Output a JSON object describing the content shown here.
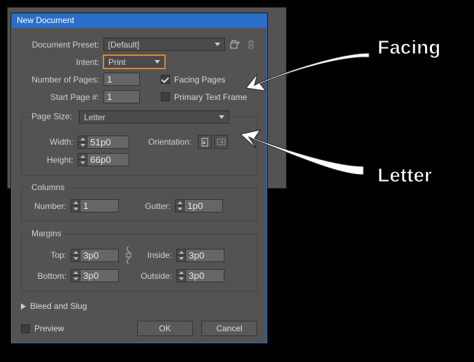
{
  "title": "New Document",
  "labels": {
    "preset": "Document Preset:",
    "intent": "Intent:",
    "numpages": "Number of Pages:",
    "startpage": "Start Page #:",
    "facing": "Facing Pages",
    "primary": "Primary Text Frame",
    "pagesize": "Page Size:",
    "width": "Width:",
    "height": "Height:",
    "orientation": "Orientation:",
    "columns": "Columns",
    "number": "Number:",
    "gutter": "Gutter:",
    "margins": "Margins",
    "top": "Top:",
    "bottom": "Bottom:",
    "inside": "Inside:",
    "outside": "Outside:",
    "bleed": "Bleed and Slug",
    "preview": "Preview",
    "ok": "OK",
    "cancel": "Cancel"
  },
  "values": {
    "preset": "[Default]",
    "intent": "Print",
    "numpages": "1",
    "startpage": "1",
    "facing_checked": true,
    "primary_checked": false,
    "pagesize": "Letter",
    "width": "51p0",
    "height": "66p0",
    "col_number": "1",
    "gutter": "1p0",
    "m_top": "3p0",
    "m_bottom": "3p0",
    "m_inside": "3p0",
    "m_outside": "3p0",
    "preview_checked": false
  },
  "annotations": {
    "facing": "Facing",
    "letter": "Letter"
  }
}
